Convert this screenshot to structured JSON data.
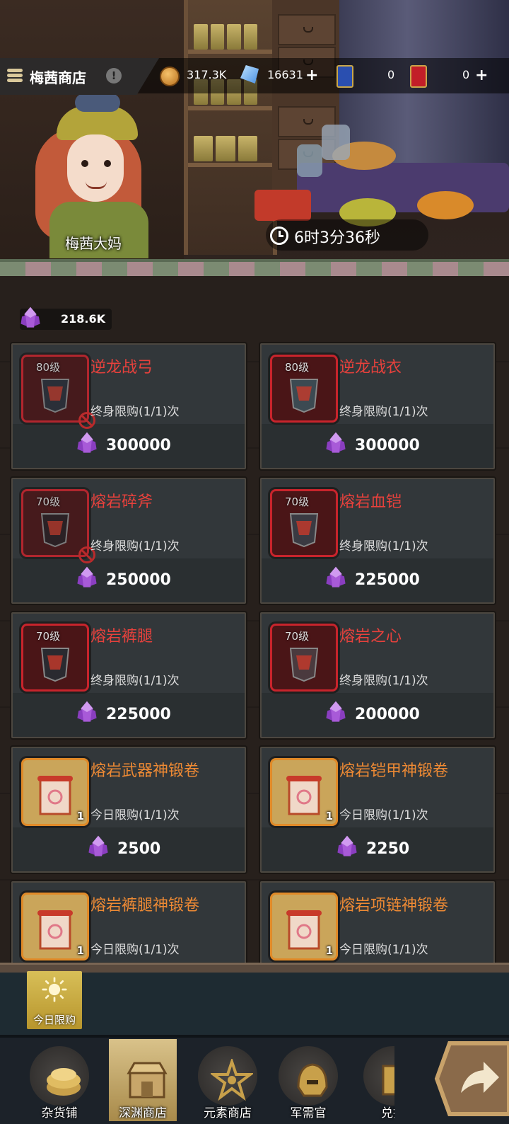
{
  "header": {
    "shop_title": "梅茜商店",
    "info_symbol": "!"
  },
  "resources": {
    "gold": "317.3K",
    "diamonds": "16631",
    "ticket_a": "0",
    "ticket_b": "0",
    "plus": "+"
  },
  "npc": {
    "name": "梅茜大妈"
  },
  "refresh_timer": "6时3分36秒",
  "currency_balance": "218.6K",
  "items": [
    {
      "level": "80级",
      "name": "逆龙战弓",
      "limit": "终身限购(1/1)次",
      "price": "300000",
      "restricted": true
    },
    {
      "level": "80级",
      "name": "逆龙战衣",
      "limit": "终身限购(1/1)次",
      "price": "300000",
      "restricted": false
    },
    {
      "level": "70级",
      "name": "熔岩碎斧",
      "limit": "终身限购(1/1)次",
      "price": "250000",
      "restricted": true
    },
    {
      "level": "70级",
      "name": "熔岩血铠",
      "limit": "终身限购(1/1)次",
      "price": "225000",
      "restricted": false
    },
    {
      "level": "70级",
      "name": "熔岩裤腿",
      "limit": "终身限购(1/1)次",
      "price": "225000",
      "restricted": false
    },
    {
      "level": "70级",
      "name": "熔岩之心",
      "limit": "终身限购(1/1)次",
      "price": "200000",
      "restricted": false
    },
    {
      "qty": "1",
      "name": "熔岩武器神锻卷",
      "limit": "今日限购(1/1)次",
      "price": "2500"
    },
    {
      "qty": "1",
      "name": "熔岩铠甲神锻卷",
      "limit": "今日限购(1/1)次",
      "price": "2250"
    },
    {
      "qty": "1",
      "name": "熔岩裤腿神锻卷",
      "limit": "今日限购(1/1)次"
    },
    {
      "qty": "1",
      "name": "熔岩项链神锻卷",
      "limit": "今日限购(1/1)次"
    }
  ],
  "daily_limit_button": "今日限购",
  "nav": {
    "tabs": [
      "杂货铺",
      "深渊商店",
      "元素商店",
      "军需官",
      "兑换"
    ],
    "active": "深渊商店"
  },
  "colors": {
    "item_name_red": "#e8413c",
    "item_name_orange": "#ee8a34",
    "gem_purple": "#a85ad8",
    "active_tab": "#d9c28a"
  }
}
